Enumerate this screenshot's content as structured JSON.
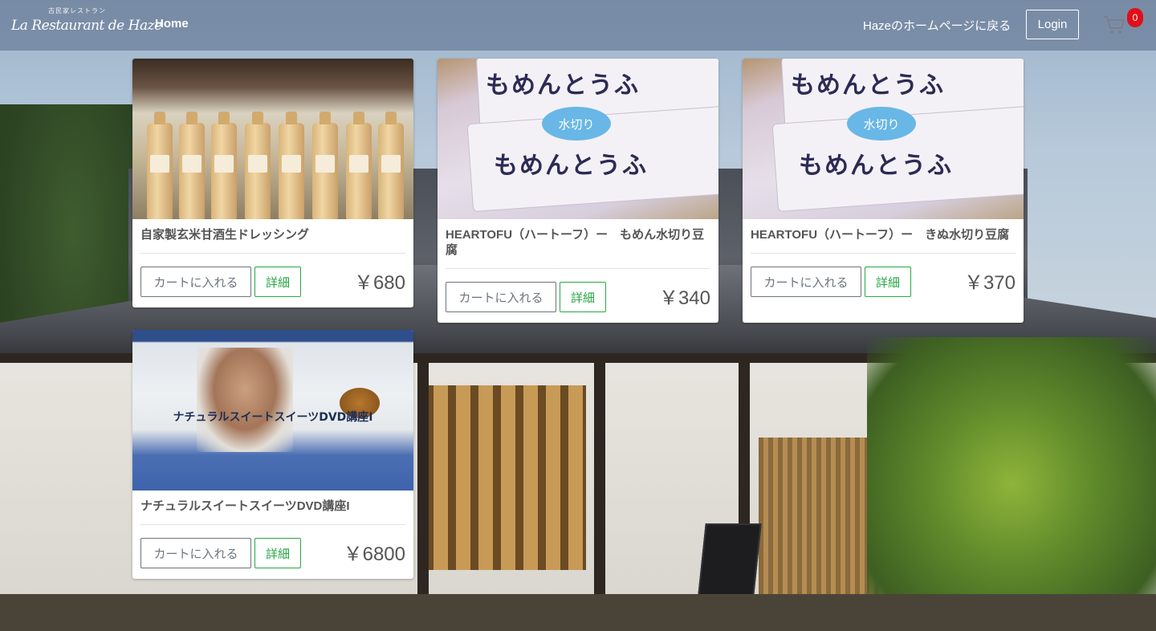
{
  "navbar": {
    "brand_sub": "古民家レストラン",
    "brand_script": "La Restaurant de Haze",
    "home_label": "Home",
    "back_link": "Hazeのホームページに戻る",
    "login_label": "Login",
    "cart_icon": "cart-icon",
    "cart_count": "0",
    "badge_color": "#e10f19"
  },
  "products": [
    {
      "name": "自家製玄米甘酒生ドレッシング",
      "cart_label": "カートに入れる",
      "detail_label": "詳細",
      "price": "￥680"
    },
    {
      "name": "HEARTOFU（ハートーフ）ー　もめん水切り豆腐",
      "cart_label": "カートに入れる",
      "detail_label": "詳細",
      "price": "￥340",
      "pack_text": "もめんとうふ",
      "mizu_text": "水切り"
    },
    {
      "name": "HEARTOFU（ハートーフ）ー　きぬ水切り豆腐",
      "cart_label": "カートに入れる",
      "detail_label": "詳細",
      "price": "￥370",
      "pack_text": "もめんとうふ",
      "mizu_text": "水切り"
    },
    {
      "name": "ナチュラルスイートスイーツDVD講座I",
      "cart_label": "カートに入れる",
      "detail_label": "詳細",
      "price": "￥6800",
      "dvd_title": "ナチュラルスイートスイーツDVD講座Ⅰ"
    }
  ],
  "colors": {
    "detail_button": "#28a745",
    "cart_button": "#6c757d"
  }
}
